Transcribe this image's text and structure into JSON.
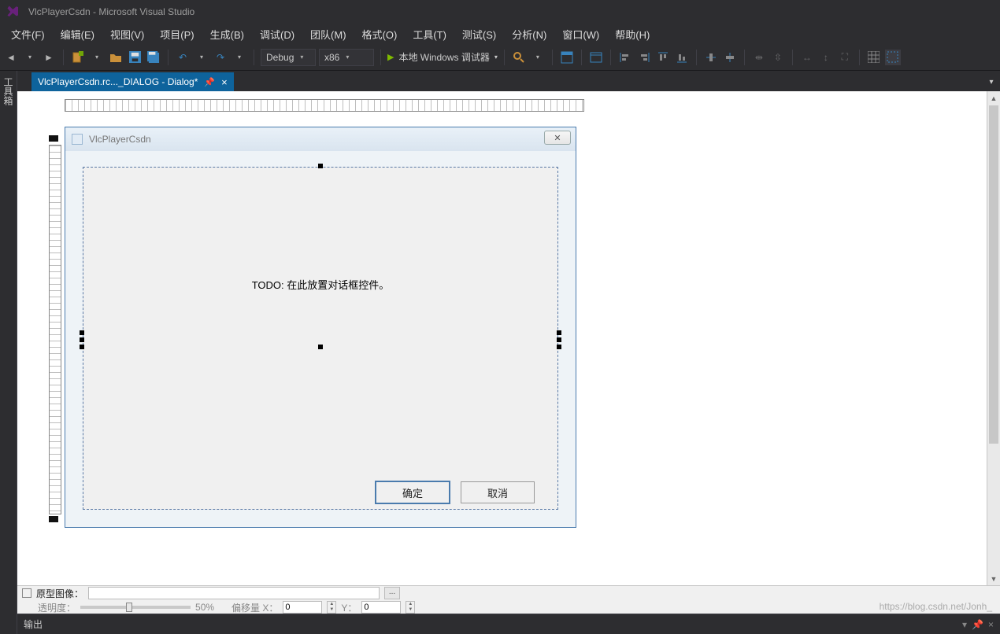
{
  "title": "VlcPlayerCsdn - Microsoft Visual Studio",
  "menu": {
    "file": "文件(F)",
    "edit": "编辑(E)",
    "view": "视图(V)",
    "project": "项目(P)",
    "build": "生成(B)",
    "debug": "调试(D)",
    "team": "团队(M)",
    "format": "格式(O)",
    "tools": "工具(T)",
    "test": "测试(S)",
    "analyze": "分析(N)",
    "window": "窗口(W)",
    "help": "帮助(H)"
  },
  "toolbar": {
    "config": "Debug",
    "platform": "x86",
    "debugger": "本地 Windows 调试器"
  },
  "side_panel": "工具箱",
  "tab": {
    "title": "VlcPlayerCsdn.rc..._DIALOG - Dialog*"
  },
  "dialog": {
    "caption": "VlcPlayerCsdn",
    "todo": "TODO: 在此放置对话框控件。",
    "ok": "确定",
    "cancel": "取消"
  },
  "props": {
    "proto_image": "原型图像：",
    "opacity_label": "透明度：",
    "opacity_val": "50%",
    "offset_x": "偏移量 X：",
    "x_val": "0",
    "y_label": "Y：",
    "y_val": "0"
  },
  "output": "输出",
  "watermark": "https://blog.csdn.net/Jonh_"
}
